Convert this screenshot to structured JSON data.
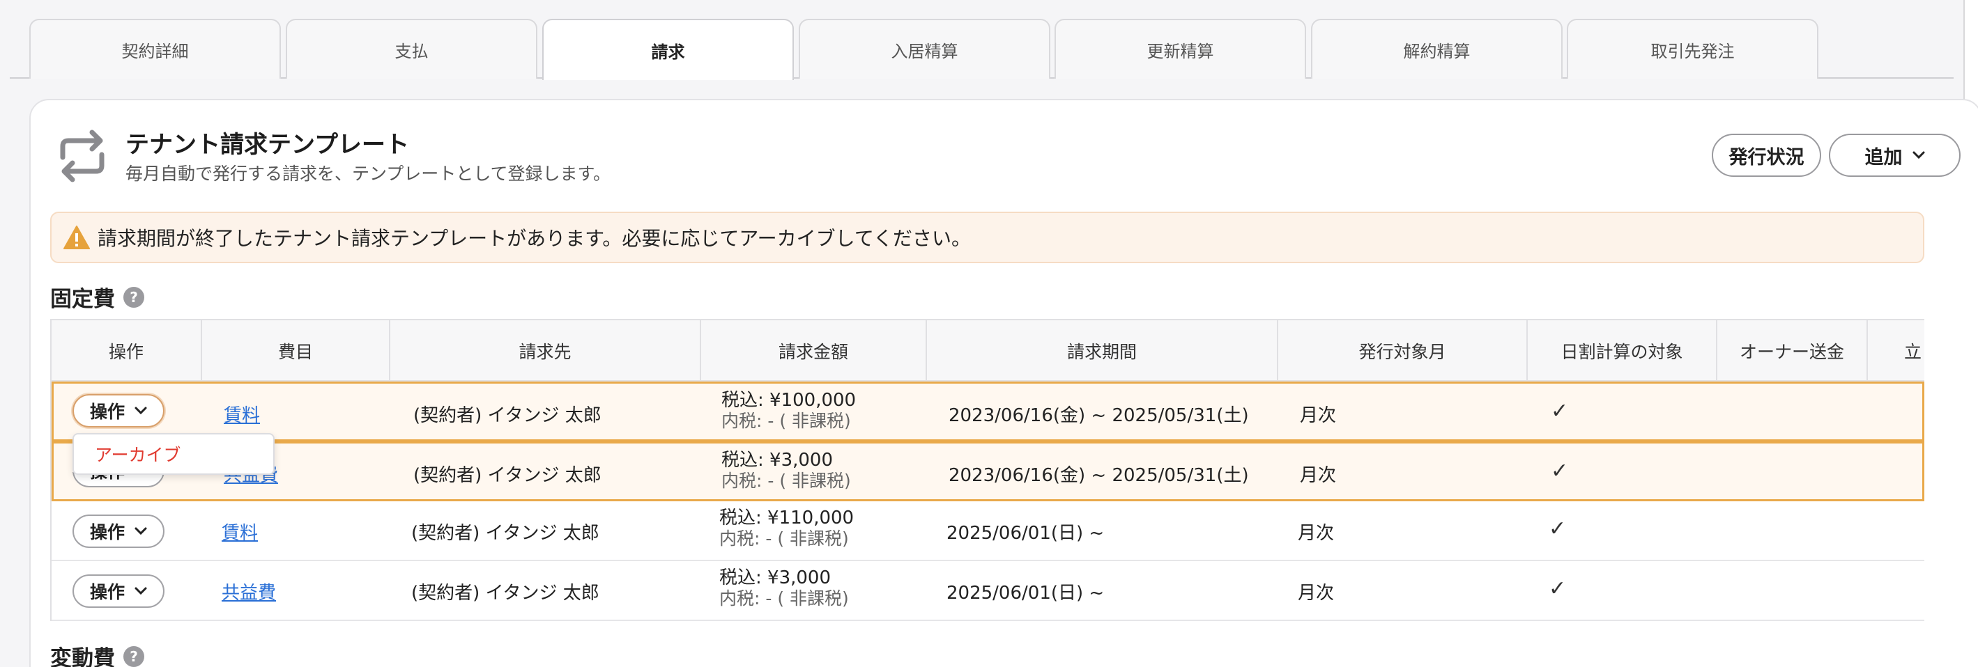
{
  "tabs": [
    "契約詳細",
    "支払",
    "請求",
    "入居精算",
    "更新精算",
    "解約精算",
    "取引先発注"
  ],
  "active_tab": "請求",
  "card": {
    "title": "テナント請求テンプレート",
    "subtitle": "毎月自動で発行する請求を、テンプレートとして登録します。",
    "status_button": "発行状況",
    "add_button": "追加"
  },
  "alert": {
    "text": "請求期間が終了したテナント請求テンプレートがあります。必要に応じてアーカイブしてください。"
  },
  "sections": {
    "fixed": "固定費",
    "variable": "変動費",
    "help_glyph": "?"
  },
  "table": {
    "headers": [
      "操作",
      "費目",
      "請求先",
      "請求金額",
      "請求期間",
      "発行対象月",
      "日割計算の対象",
      "オーナー送金",
      "立"
    ],
    "rows": [
      {
        "op": "操作",
        "item": "賃料",
        "payee": "(契約者) イタンジ 太郎",
        "amount": "税込: ¥100,000",
        "tax": "内税: - ( 非課税)",
        "period": "2023/06/16(金) ~ 2025/05/31(土)",
        "month": "月次",
        "prorate": "✓"
      },
      {
        "op": "操作",
        "item": "共益費",
        "payee": "(契約者) イタンジ 太郎",
        "amount": "税込: ¥3,000",
        "tax": "内税: - ( 非課税)",
        "period": "2023/06/16(金) ~ 2025/05/31(土)",
        "month": "月次",
        "prorate": "✓"
      },
      {
        "op": "操作",
        "item": "賃料",
        "payee": "(契約者) イタンジ 太郎",
        "amount": "税込: ¥110,000",
        "tax": "内税: - ( 非課税)",
        "period": "2025/06/01(日) ~",
        "month": "月次",
        "prorate": "✓"
      },
      {
        "op": "操作",
        "item": "共益費",
        "payee": "(契約者) イタンジ 太郎",
        "amount": "税込: ¥3,000",
        "tax": "内税: - ( 非課税)",
        "period": "2025/06/01(日) ~",
        "month": "月次",
        "prorate": "✓"
      }
    ]
  },
  "dropdown": {
    "items": [
      "アーカイブ"
    ]
  },
  "colors": {
    "accent_link": "#2a6fd6",
    "highlight_border": "#e9a94a",
    "alert_bg": "#fdf3ea",
    "danger_text": "#e03a2f",
    "warning_icon": "#e6a23c"
  },
  "icons": {
    "header": "repeat-icon",
    "alert": "warning-icon",
    "button_chevron": "chevron-down-icon"
  }
}
